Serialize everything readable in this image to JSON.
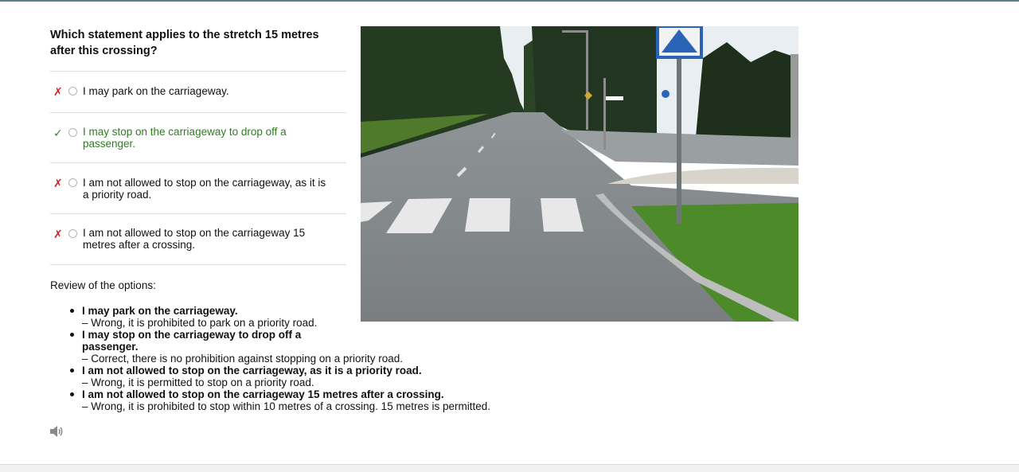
{
  "question": {
    "text": "Which statement applies to the stretch 15 metres after this crossing?"
  },
  "options": [
    {
      "mark": "✗",
      "result": "wrong",
      "text": "I may park on the carriageway."
    },
    {
      "mark": "✓",
      "result": "correct",
      "text": "I may stop on the carriageway to drop off a passenger."
    },
    {
      "mark": "✗",
      "result": "wrong",
      "text": "I am not allowed to stop on the carriageway, as it is a priority road."
    },
    {
      "mark": "✗",
      "result": "wrong",
      "text": "I am not allowed to stop on the carriageway 15 metres after a crossing."
    }
  ],
  "review": {
    "title": "Review of the options:",
    "items": [
      {
        "option": "I may park on the carriageway.",
        "explanation": "– Wrong, it is prohibited to park on a priority road."
      },
      {
        "option": "I may stop on the carriageway to drop off a passenger.",
        "explanation": "– Correct, there is no prohibition against stopping on a priority road."
      },
      {
        "option": "I am not allowed to stop on the carriageway, as it is a priority road.",
        "explanation": "– Wrong, it is permitted to stop on a priority road."
      },
      {
        "option": "I am not allowed to stop on the carriageway 15 metres after a crossing.",
        "explanation": "– Wrong, it is prohibited to stop within 10 metres of a crossing. 15 metres is permitted."
      }
    ]
  },
  "audio": {
    "icon": "speaker-icon"
  },
  "image": {
    "subject": "road-crossing-photo"
  },
  "colors": {
    "wrong": "#d21f1f",
    "correct": "#2e7d1f",
    "accent_rule": "#5b7f8f"
  }
}
